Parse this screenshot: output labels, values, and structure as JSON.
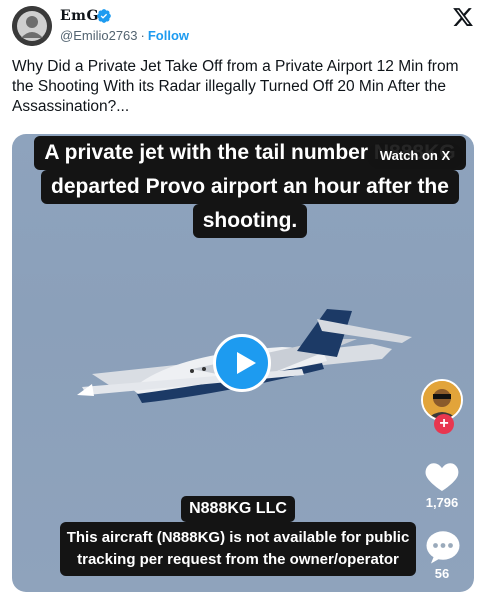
{
  "author": {
    "display_name": "EmG",
    "handle": "@Emilio2763",
    "separator": "·",
    "follow_label": "Follow"
  },
  "tweet": {
    "text": "Why Did a Private Jet Take Off from a Private Airport 12 Min from the Shooting With its Radar illegally Turned Off 20 Min After the Assassination?..."
  },
  "video": {
    "caption_lines": [
      "A private jet with the tail number N888KG",
      "departed Provo airport an hour after the",
      "shooting."
    ],
    "watch_label": "Watch on X",
    "likes_count": "1,796",
    "comments_count": "56",
    "bottom_title": "N888KG LLC",
    "bottom_body": "This aircraft (N888KG) is not available for public tracking per request from the owner/operator"
  },
  "colors": {
    "accent": "#1d9bf0",
    "plus_red": "#e8364f",
    "caption_bg": "#141414"
  },
  "icons": {
    "brand": "x-logo-icon",
    "verified": "verified-badge-icon",
    "play": "play-icon",
    "like": "heart-icon",
    "comment": "comment-bubble-icon",
    "add": "plus-icon"
  }
}
